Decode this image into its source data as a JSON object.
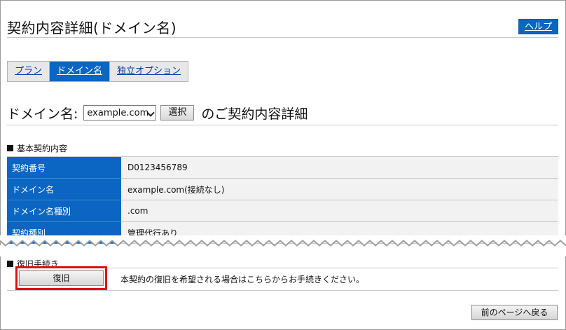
{
  "header": {
    "title": "契約内容詳細(ドメイン名)",
    "help_label": "ヘルプ"
  },
  "tabs": [
    {
      "label": "プラン",
      "active": false
    },
    {
      "label": "ドメイン名",
      "active": true
    },
    {
      "label": "独立オプション",
      "active": false
    }
  ],
  "domain_selector": {
    "label": "ドメイン名:",
    "selected": "example.com",
    "button_label": "選択",
    "suffix": "のご契約内容詳細"
  },
  "basic_section": {
    "title": "基本契約内容",
    "rows": [
      {
        "label": "契約番号",
        "value": "D0123456789"
      },
      {
        "label": "ドメイン名",
        "value": "example.com(接続なし)"
      },
      {
        "label": "ドメイン名種別",
        "value": ".com"
      },
      {
        "label": "契約種別",
        "value": "管理代行あり"
      }
    ]
  },
  "restore_section": {
    "title": "復旧手続き",
    "button_label": "復旧",
    "description": "本契約の復旧を希望される場合はこちらからお手続きください。"
  },
  "footer": {
    "back_label": "前のページへ戻る"
  },
  "colors": {
    "accent": "#0a66c2",
    "highlight": "#e01010",
    "row_bg": "#f2f2f2"
  }
}
